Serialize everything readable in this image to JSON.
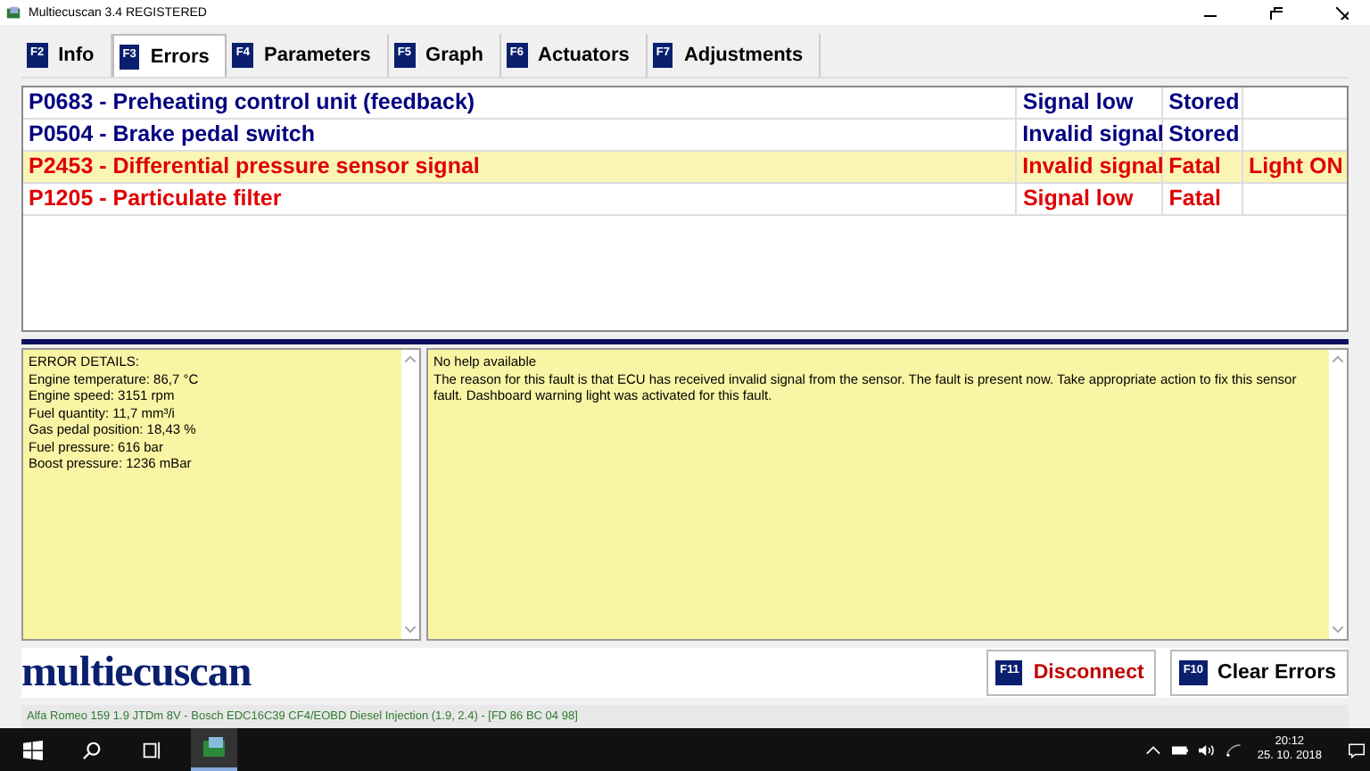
{
  "window": {
    "title": "Multiecuscan 3.4 REGISTERED"
  },
  "tabs": [
    {
      "key": "F2",
      "label": "Info",
      "selected": false
    },
    {
      "key": "F3",
      "label": "Errors",
      "selected": true
    },
    {
      "key": "F4",
      "label": "Parameters",
      "selected": false
    },
    {
      "key": "F5",
      "label": "Graph",
      "selected": false
    },
    {
      "key": "F6",
      "label": "Actuators",
      "selected": false
    },
    {
      "key": "F7",
      "label": "Adjustments",
      "selected": false
    }
  ],
  "errors": [
    {
      "code": "P0683 - Preheating control unit (feedback)",
      "type": "Signal low",
      "status": "Stored",
      "color": "#000080",
      "selected": false
    },
    {
      "code": "P0504 - Brake pedal switch",
      "type": "Invalid signal",
      "status": "Stored",
      "color": "#000080",
      "selected": false
    },
    {
      "code": "P2453 - Differential pressure sensor signal",
      "type": "Invalid signal",
      "status": "Fatal",
      "light": "Light ON",
      "color": "#e00000",
      "selected": true
    },
    {
      "code": "P1205 - Particulate filter",
      "type": "Signal low",
      "status": "Fatal",
      "color": "#e00000",
      "selected": false
    }
  ],
  "details": [
    "ERROR DETAILS:",
    "Engine temperature: 86,7 °C",
    "Engine speed: 3151 rpm",
    "Fuel quantity: 11,7 mm³/i",
    "Gas pedal position: 18,43 %",
    "Fuel pressure: 616 bar",
    "Boost pressure: 1236 mBar"
  ],
  "help": [
    "No help available",
    "The reason for this fault is that ECU has received invalid signal from the sensor. The fault is present now. Take appropriate action to fix this sensor fault. Dashboard warning light was activated for this fault."
  ],
  "logo": "multiecuscan",
  "buttons": [
    {
      "key": "F11",
      "label": "Disconnect",
      "kind": "danger"
    },
    {
      "key": "F10",
      "label": "Clear Errors",
      "kind": "normal"
    }
  ],
  "status_bar": "Alfa Romeo 159 1.9 JTDm 8V - Bosch EDC16C39 CF4/EOBD Diesel Injection (1.9, 2.4) - [FD 86 BC 04 98]",
  "taskbar": {
    "time": "20:12",
    "date": "25. 10. 2018"
  }
}
